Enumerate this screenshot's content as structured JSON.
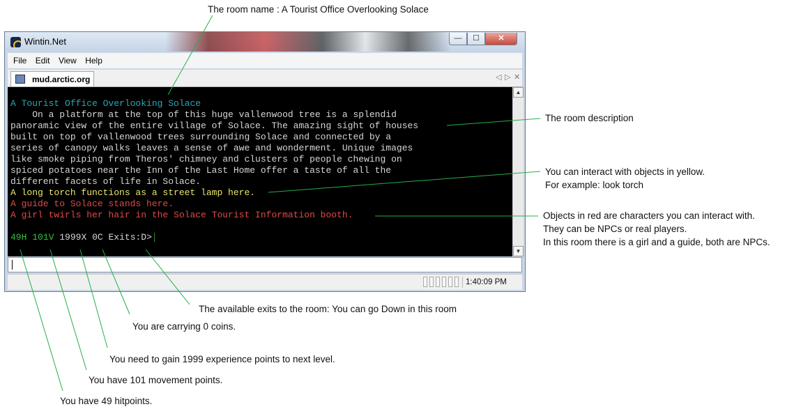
{
  "window": {
    "title": "Wintin.Net",
    "min_glyph": "—",
    "max_glyph": "☐",
    "close_glyph": "✕"
  },
  "menu": {
    "file": "File",
    "edit": "Edit",
    "view": "View",
    "help": "Help"
  },
  "tab": {
    "label": "mud.arctic.org",
    "prev_glyph": "◁",
    "next_glyph": "▷",
    "close_glyph": "✕"
  },
  "terminal": {
    "room_name": "A Tourist Office Overlooking Solace",
    "description": [
      "    On a platform at the top of this huge vallenwood tree is a splendid",
      "panoramic view of the entire village of Solace. The amazing sight of houses",
      "built on top of vallenwood trees surrounding Solace and connected by a",
      "series of canopy walks leaves a sense of awe and wonderment. Unique images",
      "like smoke piping from Theros' chimney and clusters of people chewing on",
      "spiced potatoes near the Inn of the Last Home offer a taste of all the",
      "different facets of life in Solace."
    ],
    "object_line": "A long torch functions as a street lamp here.",
    "character_lines": [
      "A guide to Solace stands here.",
      "A girl twirls her hair in the Solace Tourist Information booth."
    ],
    "prompt": {
      "hp": "49H",
      "mv": "101V",
      "xp": "1999X",
      "coins": "0C",
      "exits": "Exits:D>"
    },
    "colors": {
      "room": "#2aa7b4",
      "text": "#d6d6d6",
      "object": "#e9e66b",
      "character": "#e04848",
      "stats": "#33c33b"
    }
  },
  "status": {
    "time": "1:40:09 PM"
  },
  "annotations": {
    "room_name": "The room name : A Tourist Office Overlooking Solace",
    "description": "The room description",
    "objects_1": "You can interact with objects in yellow.",
    "objects_2": "For example: look torch",
    "chars_1": "Objects in red are characters you can interact with.",
    "chars_2": "They can be NPCs or real players.",
    "chars_3": "In this room there is a girl and a guide, both are NPCs.",
    "exits": "The available exits to the room: You can go Down in this room",
    "coins": "You are carrying 0 coins.",
    "xp": "You need to gain 1999 experience points to next level.",
    "mv": "You have 101 movement points.",
    "hp": "You have 49 hitpoints."
  }
}
